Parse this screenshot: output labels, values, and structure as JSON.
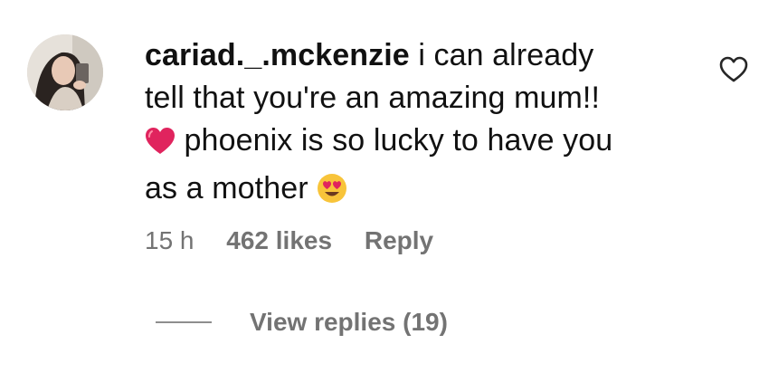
{
  "comment": {
    "username": "cariad._.mckenzie",
    "text_line1": "i can already",
    "text_line2": "tell that you're an amazing mum!!",
    "text_line3": "phoenix is so lucky to have you",
    "text_line4": "as a mother",
    "leading_emoji": "red-heart-icon",
    "trailing_emoji": "heart-eyes-emoji-icon"
  },
  "meta": {
    "time": "15 h",
    "likes": "462 likes",
    "reply_label": "Reply"
  },
  "replies": {
    "label": "View replies (19)"
  },
  "colors": {
    "text": "#111111",
    "secondary": "#737373",
    "heart_red": "#e0245e"
  }
}
